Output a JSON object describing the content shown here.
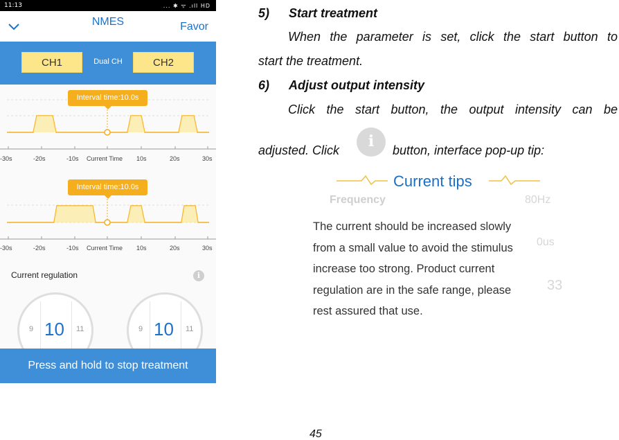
{
  "phone": {
    "status_time": "11:13",
    "status_icons": "... ✱ ᯤ .ıll HD",
    "title": "NMES",
    "favor_label": "Favor",
    "channels": {
      "ch1": "CH1",
      "dual": "Dual CH",
      "ch2": "CH2"
    },
    "wave_plots": [
      {
        "tooltip": "Interval time:10.0s"
      },
      {
        "tooltip": "Interval time:10.0s"
      }
    ],
    "axis_ticks": [
      "-30s",
      "-20s",
      "-10s",
      "Current Time",
      "10s",
      "20s",
      "30s"
    ],
    "regulation_label": "Current regulation",
    "dials": [
      {
        "prev": "9",
        "value": "10",
        "next": "11"
      },
      {
        "prev": "9",
        "value": "10",
        "next": "11"
      }
    ],
    "stop_button": "Press and hold to stop treatment",
    "colors": {
      "accent_blue": "#3e8fd8",
      "title_blue": "#1d72c8",
      "channel_yellow": "#fde68a",
      "tooltip_orange": "#f5ae1e"
    }
  },
  "manual": {
    "h5_num": "5)",
    "h5_text": "Start treatment",
    "p5_line1": "When the parameter is set, click the start button to",
    "p5_line2": "start the treatment.",
    "h6_num": "6)",
    "h6_text": "Adjust output intensity",
    "p6_line1": "Click the start button, the output intensity can be",
    "p6_line2_left": "adjusted. Click",
    "p6_line2_right": "button, interface pop-up tip:",
    "page_number": "45"
  },
  "tips": {
    "title": "Current tips",
    "ghost_frequency": "Frequency",
    "ghost_hz": "80Hz",
    "ghost_us": "0us",
    "ghost_33": "33",
    "body": "The current should be increased slowly\nfrom a small value to avoid the stimulus\nincrease too strong. Product current\nregulation are in the safe range, please\nrest assured that use."
  }
}
